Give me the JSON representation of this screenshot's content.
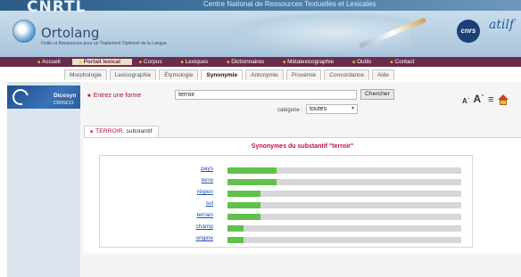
{
  "banner": {
    "site_name": "CNRTL",
    "centre_name": "Centre National de Ressources Textuelles et Lexicales",
    "ortolang_name": "Ortolang",
    "ortolang_tagline": "Outils et Ressources pour un Traitement Optimisé de la Langue",
    "cnrs_logo": "cnrs",
    "atilf_logo": "atilf"
  },
  "nav": {
    "items": [
      {
        "label": "Accueil",
        "active": false
      },
      {
        "label": "Portail lexical",
        "active": true
      },
      {
        "label": "Corpus",
        "active": false
      },
      {
        "label": "Lexiques",
        "active": false
      },
      {
        "label": "Dictionnaires",
        "active": false
      },
      {
        "label": "Métalexicographie",
        "active": false
      },
      {
        "label": "Outils",
        "active": false
      },
      {
        "label": "Contact",
        "active": false
      }
    ]
  },
  "subtabs": [
    {
      "label": "Morphologie",
      "active": false
    },
    {
      "label": "Lexicographie",
      "active": false
    },
    {
      "label": "Étymologie",
      "active": false
    },
    {
      "label": "Synonymie",
      "active": true
    },
    {
      "label": "Antonymie",
      "active": false
    },
    {
      "label": "Proxémie",
      "active": false
    },
    {
      "label": "Concordance",
      "active": false
    },
    {
      "label": "Aide",
      "active": false
    }
  ],
  "sidebar": {
    "title": "Dicosyn",
    "subtitle": "CRISCO"
  },
  "search": {
    "label": "Entrez une forme",
    "value": "terroir",
    "button": "Chercher",
    "category_label": "catégorie :",
    "category_value": "toutes"
  },
  "result": {
    "tab_word": "TERROIR",
    "tab_pos": ", substantif",
    "title": "Synonymes du substantif \"terroir\"",
    "synonyms": [
      {
        "word": "pays",
        "score": 0.21
      },
      {
        "word": "terre",
        "score": 0.21
      },
      {
        "word": "région",
        "score": 0.14
      },
      {
        "word": "sol",
        "score": 0.14
      },
      {
        "word": "terrain",
        "score": 0.14
      },
      {
        "word": "champ",
        "score": 0.07
      },
      {
        "word": "origine",
        "score": 0.07
      }
    ]
  },
  "colors": {
    "nav_bg": "#6a2c4a",
    "bar_fill": "#60c24a",
    "bar_track": "#d7d7d7",
    "accent_red": "#c01040",
    "link_blue": "#1c4fa8"
  }
}
